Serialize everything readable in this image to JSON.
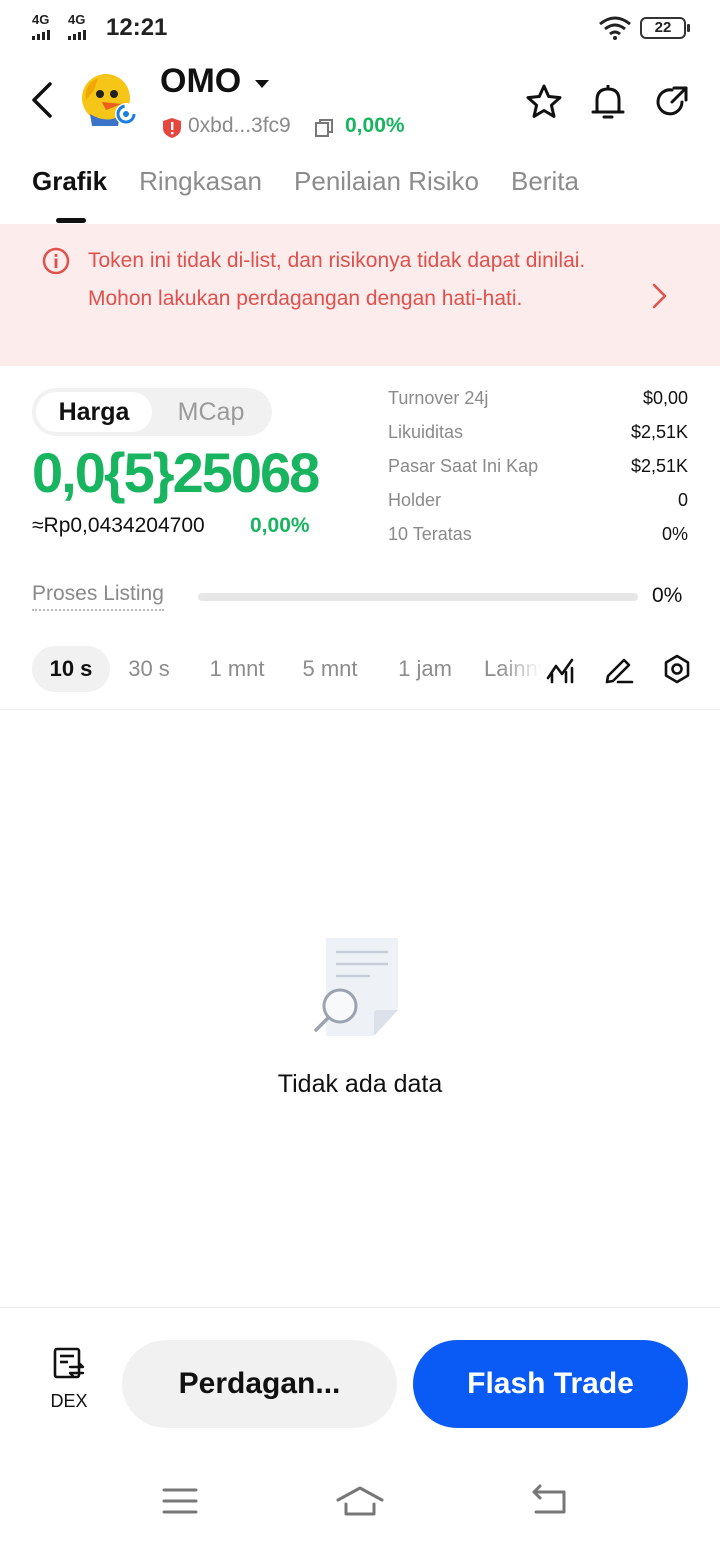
{
  "status_bar": {
    "network_1": "4G",
    "network_2": "4G",
    "time": "12:21",
    "battery": "22"
  },
  "header": {
    "token_name": "OMO",
    "address": "0xbd...3fc9",
    "change": "0,00%"
  },
  "tabs": [
    "Grafik",
    "Ringkasan",
    "Penilaian Risiko",
    "Berita"
  ],
  "warning": {
    "text": "Token ini tidak di-list, dan risikonya tidak dapat dinilai. Mohon lakukan perdagangan dengan hati-hati."
  },
  "price": {
    "toggle": [
      "Harga",
      "MCap"
    ],
    "value": "0,0{5}25068",
    "idr": "≈Rp0,0434204700",
    "change": "0,00%"
  },
  "stats": [
    {
      "label": "Turnover 24j",
      "value": "$0,00"
    },
    {
      "label": "Likuiditas",
      "value": "$2,51K"
    },
    {
      "label": "Pasar Saat Ini Kap",
      "value": "$2,51K"
    },
    {
      "label": "Holder",
      "value": "0"
    },
    {
      "label": "10 Teratas",
      "value": "0%"
    }
  ],
  "listing": {
    "label": "Proses Listing",
    "percent": "0%",
    "progress": 0
  },
  "timeframes": [
    "10 s",
    "30 s",
    "1 mnt",
    "5 mnt",
    "1 jam",
    "Lainnya"
  ],
  "empty_state": {
    "text": "Tidak ada data"
  },
  "bottom": {
    "dex_label": "DEX",
    "trade_label": "Perdagan...",
    "flash_label": "Flash Trade"
  },
  "colors": {
    "positive": "#18b45f",
    "warning_text": "#e0504c",
    "warning_bg": "#fdecec",
    "primary": "#0a5af5"
  }
}
